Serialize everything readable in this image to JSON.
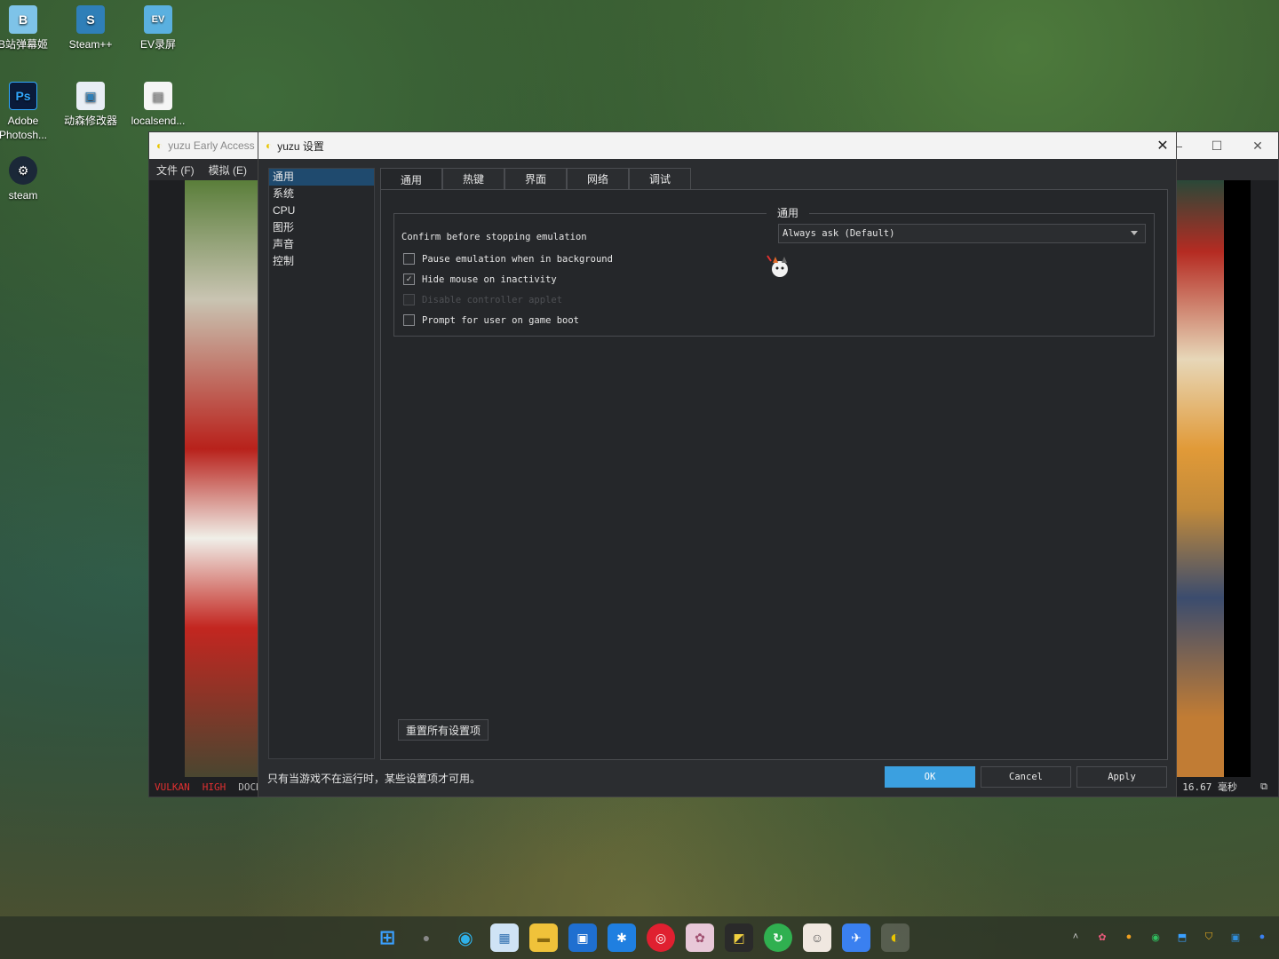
{
  "desktop": {
    "icons": [
      {
        "label": "B站弹幕姬",
        "glyph": "B"
      },
      {
        "label": "Steam++",
        "glyph": "S"
      },
      {
        "label": "EV录屏",
        "glyph": "EV"
      },
      {
        "label": "Adobe Photosh...",
        "glyph": "Ps"
      },
      {
        "label": "动森修改器",
        "glyph": "▣"
      },
      {
        "label": "localsend...",
        "glyph": "▤"
      },
      {
        "label": "steam",
        "glyph": "⚙"
      }
    ]
  },
  "main_window": {
    "title": "yuzu Early Access",
    "menu": [
      "文件 (F)",
      "模拟 (E)"
    ],
    "status": {
      "api": "VULKAN",
      "accuracy": "HIGH",
      "mode": "DOCKE",
      "frametime": "16.67 毫秒"
    }
  },
  "dialog": {
    "title": "yuzu 设置",
    "nav": [
      "通用",
      "系统",
      "CPU",
      "图形",
      "声音",
      "控制"
    ],
    "tabs": [
      "通用",
      "热键",
      "界面",
      "网络",
      "调试"
    ],
    "group_title": "通用",
    "confirm_label": "Confirm before stopping emulation",
    "confirm_value": "Always ask (Default)",
    "checkboxes": [
      {
        "label": "Pause emulation when in background",
        "checked": false,
        "disabled": false
      },
      {
        "label": "Hide mouse on inactivity",
        "checked": true,
        "disabled": false
      },
      {
        "label": "Disable controller applet",
        "checked": false,
        "disabled": true
      },
      {
        "label": "Prompt for user on game boot",
        "checked": false,
        "disabled": false
      }
    ],
    "reset_label": "重置所有设置项",
    "footer_note": "只有当游戏不在运行时，某些设置项才可用。",
    "ok_label": "OK",
    "cancel_label": "Cancel",
    "apply_label": "Apply"
  },
  "colors": {
    "accent": "#3ba0e0",
    "nav_active": "#1f4a6e",
    "status_red": "#e03030"
  }
}
